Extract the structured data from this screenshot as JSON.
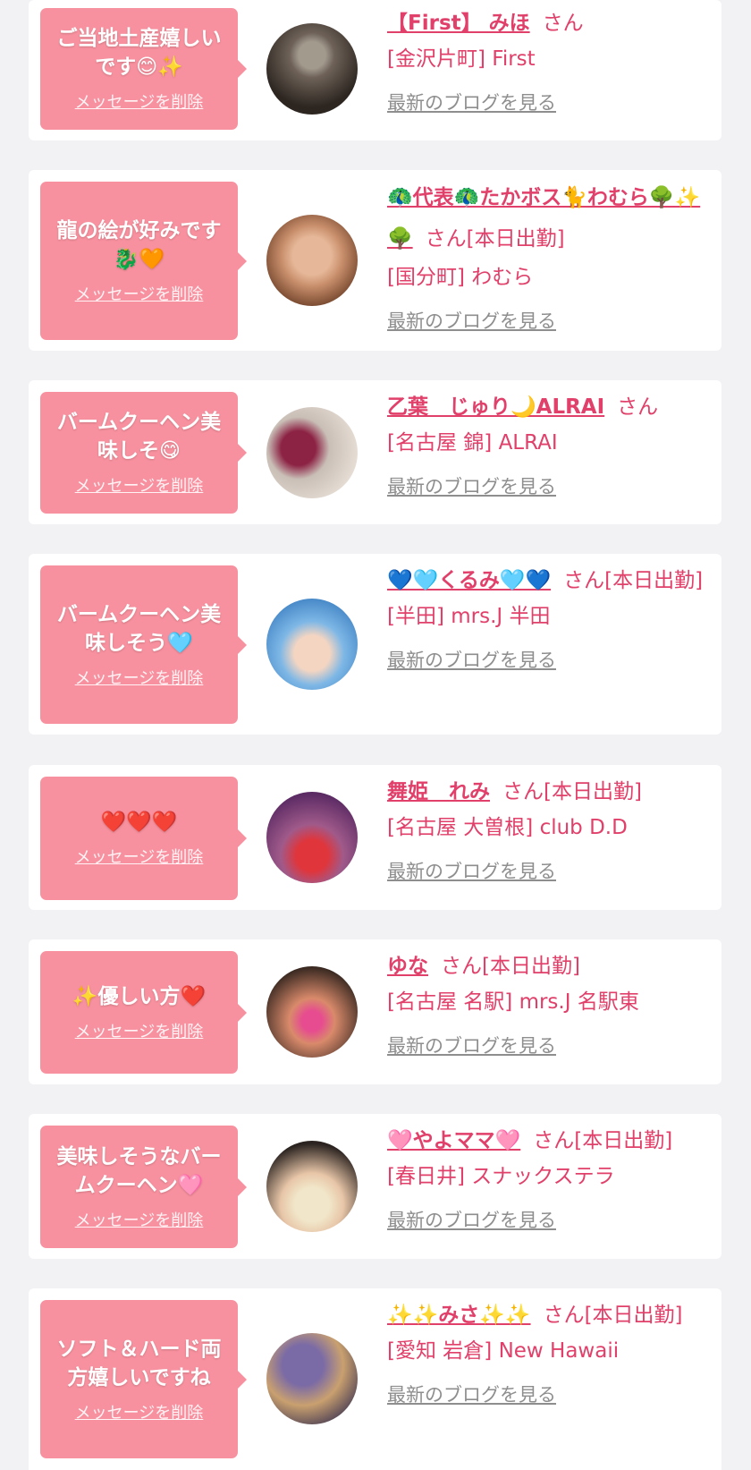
{
  "entries": [
    {
      "message": "ご当地土産嬉しいです😊✨",
      "delete_label": "メッセージを削除",
      "name": "【First】 みほ",
      "suffix": "さん",
      "shop": "[金沢片町] First",
      "blog_link": "最新のブログを見る",
      "avatar_colors": [
        "#6e6258",
        "#2c2520",
        "#a39a8e"
      ]
    },
    {
      "message": "龍の絵が好みです🐉🧡",
      "delete_label": "メッセージを削除",
      "name": "🦚代表🦚たかボス🐈わむら🌳✨🌳",
      "suffix": "さん[本日出勤]",
      "shop": "[国分町] わむら",
      "blog_link": "最新のブログを見る",
      "avatar_colors": [
        "#c98f6c",
        "#6b3e26",
        "#e6b899"
      ]
    },
    {
      "message": "バームクーヘン美味しそ😋",
      "delete_label": "メッセージを削除",
      "name": "乙葉　じゅり🌙ALRAI",
      "suffix": "さん",
      "shop": "[名古屋 錦] ALRAI",
      "blog_link": "最新のブログを見る",
      "avatar_colors": [
        "#c9bfb7",
        "#8c2244",
        "#e8dfd6"
      ]
    },
    {
      "message": "バームクーヘン美味しそう🩵",
      "delete_label": "メッセージを削除",
      "name": "💙🩵くるみ🩵💙",
      "suffix": "さん[本日出勤]",
      "shop": "[半田] mrs.J 半田",
      "blog_link": "最新のブログを見る",
      "avatar_colors": [
        "#7db7e6",
        "#f3d5c2",
        "#3a7dc0"
      ]
    },
    {
      "message": "❤️❤️❤️",
      "delete_label": "メッセージを削除",
      "name": "舞姫　れみ",
      "suffix": "さん[本日出勤]",
      "shop": "[名古屋 大曽根] club D.D",
      "blog_link": "最新のブログを見る",
      "avatar_colors": [
        "#5a2a63",
        "#e0353b",
        "#a05a8a"
      ]
    },
    {
      "message": "✨優しい方❤️",
      "delete_label": "メッセージを削除",
      "name": "ゆな",
      "suffix": "さん[本日出勤]",
      "shop": "[名古屋 名駅] mrs.J 名駅東",
      "blog_link": "最新のブログを見る",
      "avatar_colors": [
        "#3b2a22",
        "#d98a6b",
        "#e64c8f"
      ]
    },
    {
      "message": "美味しそうなバームクーヘン🩷",
      "delete_label": "メッセージを削除",
      "name": "🩷やよママ🩷",
      "suffix": "さん[本日出勤]",
      "shop": "[春日井] スナックステラ",
      "blog_link": "最新のブログを見る",
      "avatar_colors": [
        "#2b2320",
        "#e8c6a8",
        "#f1e6c9"
      ]
    },
    {
      "message": "ソフト＆ハード両方嬉しいですね",
      "delete_label": "メッセージを削除",
      "name": "✨✨みさ✨✨",
      "suffix": "さん[本日出勤]",
      "shop": "[愛知 岩倉] New Hawaii",
      "blog_link": "最新のブログを見る",
      "avatar_colors": [
        "#7a6aa6",
        "#c9a06f",
        "#3e3552"
      ]
    }
  ]
}
